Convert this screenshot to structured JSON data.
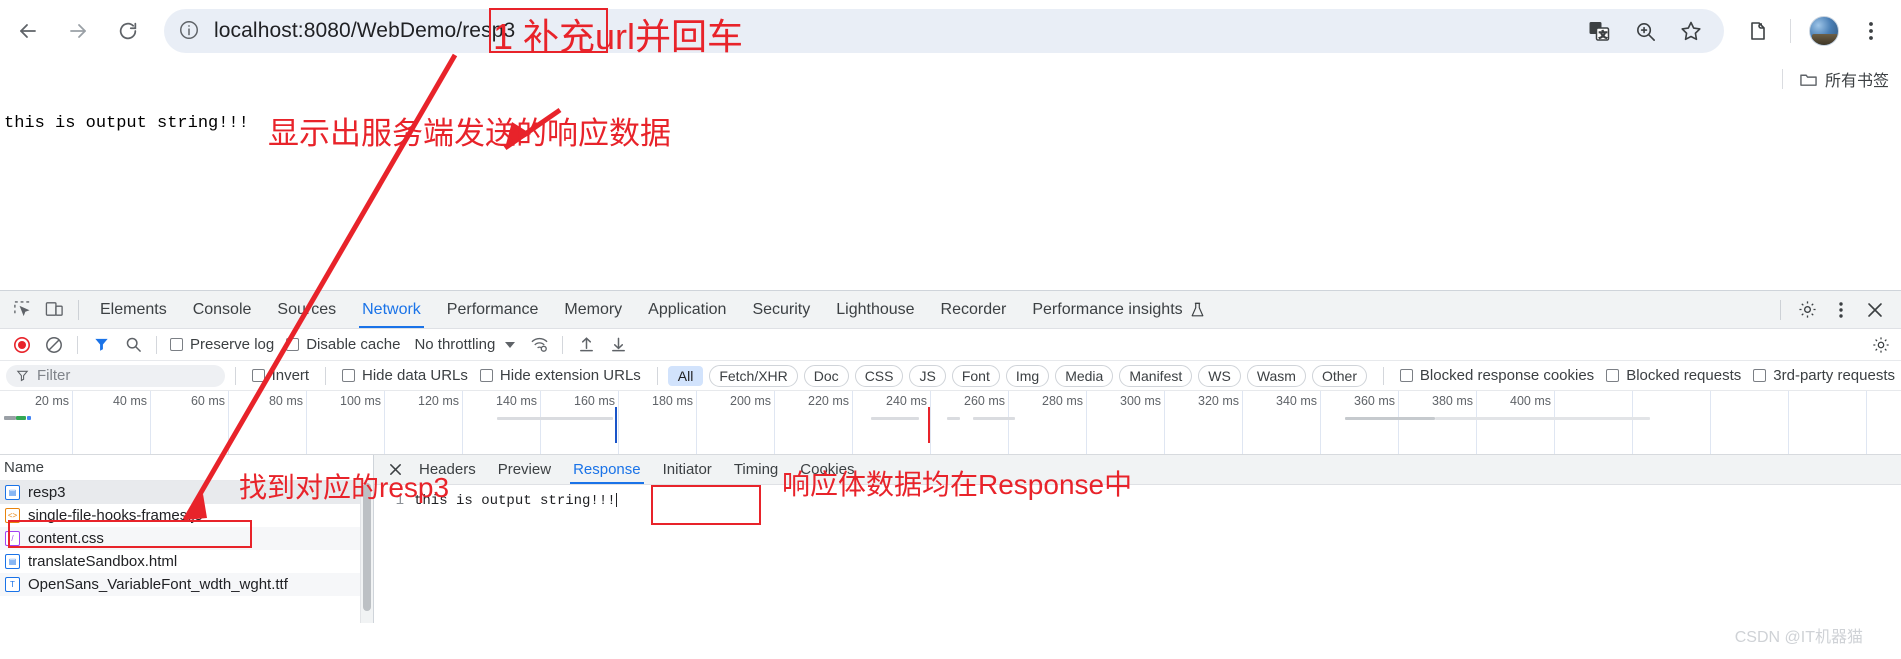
{
  "browser": {
    "back_icon": "back-arrow-icon",
    "forward_icon": "forward-arrow-icon",
    "reload_icon": "reload-icon",
    "site_info_icon": "site-info-icon",
    "url": "localhost:8080/WebDemo/resp3",
    "translate_icon": "translate-icon",
    "zoom_icon": "zoom-icon",
    "bookmark_icon": "star-icon",
    "extensions_icon": "extensions-icon",
    "profile_icon": "avatar-icon",
    "menu_icon": "three-dot-menu-icon"
  },
  "bookmarks": {
    "all_bookmarks_label": "所有书签",
    "folder_icon": "folder-icon"
  },
  "page": {
    "body_text": "this is output string!!!"
  },
  "devtools": {
    "inspect_icon": "inspect-element-icon",
    "device_icon": "device-toolbar-icon",
    "tabs": [
      {
        "label": "Elements",
        "active": false
      },
      {
        "label": "Console",
        "active": false
      },
      {
        "label": "Sources",
        "active": false
      },
      {
        "label": "Network",
        "active": true
      },
      {
        "label": "Performance",
        "active": false
      },
      {
        "label": "Memory",
        "active": false
      },
      {
        "label": "Application",
        "active": false
      },
      {
        "label": "Security",
        "active": false
      },
      {
        "label": "Lighthouse",
        "active": false
      },
      {
        "label": "Recorder",
        "active": false
      },
      {
        "label": "Performance insights",
        "active": false
      }
    ],
    "performance_insights_flask_icon": "flask-icon",
    "settings_icon": "gear-icon",
    "more_icon": "three-dot-menu-icon",
    "close_icon": "close-icon",
    "network_toolbar": {
      "record_icon": "record-stop-icon",
      "clear_icon": "clear-icon",
      "filter_icon": "filter-funnel-icon",
      "search_icon": "search-icon",
      "preserve_log_label": "Preserve log",
      "preserve_log_checked": false,
      "disable_cache_label": "Disable cache",
      "disable_cache_checked": false,
      "throttling_value": "No throttling",
      "network_conditions_icon": "wifi-settings-icon",
      "import_icon": "upload-har-icon",
      "export_icon": "download-har-icon",
      "right_settings_icon": "gear-icon"
    },
    "filter_bar": {
      "filter_placeholder": "Filter",
      "filter_value": "",
      "filter_icon": "filter-funnel-icon",
      "invert_label": "Invert",
      "invert_checked": false,
      "hide_data_urls_label": "Hide data URLs",
      "hide_data_urls_checked": false,
      "hide_extension_urls_label": "Hide extension URLs",
      "hide_extension_urls_checked": false,
      "types": [
        {
          "label": "All",
          "active": true
        },
        {
          "label": "Fetch/XHR",
          "active": false
        },
        {
          "label": "Doc",
          "active": false
        },
        {
          "label": "CSS",
          "active": false
        },
        {
          "label": "JS",
          "active": false
        },
        {
          "label": "Font",
          "active": false
        },
        {
          "label": "Img",
          "active": false
        },
        {
          "label": "Media",
          "active": false
        },
        {
          "label": "Manifest",
          "active": false
        },
        {
          "label": "WS",
          "active": false
        },
        {
          "label": "Wasm",
          "active": false
        },
        {
          "label": "Other",
          "active": false
        }
      ],
      "blocked_response_cookies_label": "Blocked response cookies",
      "blocked_response_cookies_checked": false,
      "blocked_requests_label": "Blocked requests",
      "blocked_requests_checked": false,
      "third_party_requests_label": "3rd-party requests",
      "third_party_requests_checked": false
    },
    "overview": {
      "ticks": [
        "20 ms",
        "40 ms",
        "60 ms",
        "80 ms",
        "100 ms",
        "120 ms",
        "140 ms",
        "160 ms",
        "180 ms",
        "200 ms",
        "220 ms",
        "240 ms",
        "260 ms",
        "280 ms",
        "300 ms",
        "320 ms",
        "340 ms",
        "360 ms",
        "380 ms",
        "400 ms"
      ]
    },
    "requests": {
      "name_column_header": "Name",
      "rows": [
        {
          "name": "resp3",
          "icon": "document-file-icon",
          "selected": true
        },
        {
          "name": "single-file-hooks-frames.js",
          "icon": "js-file-icon",
          "selected": false
        },
        {
          "name": "content.css",
          "icon": "css-file-icon",
          "selected": false
        },
        {
          "name": "translateSandbox.html",
          "icon": "html-file-icon",
          "selected": false
        },
        {
          "name": "OpenSans_VariableFont_wdth_wght.ttf",
          "icon": "font-file-icon",
          "selected": false
        }
      ]
    },
    "detail": {
      "close_icon": "close-icon",
      "tabs": [
        {
          "label": "Headers",
          "active": false
        },
        {
          "label": "Preview",
          "active": false
        },
        {
          "label": "Response",
          "active": true
        },
        {
          "label": "Initiator",
          "active": false
        },
        {
          "label": "Timing",
          "active": false
        },
        {
          "label": "Cookies",
          "active": false
        }
      ],
      "response_lines": [
        {
          "num": "1",
          "text": "this is output string!!!"
        }
      ]
    }
  },
  "annotations": {
    "color": "#e8232a",
    "step1": "1 补充url并回车",
    "note_response_data": "显示出服务端发送的响应数据",
    "note_find_resp3": "找到对应的resp3",
    "note_response_tab": "响应体数据均在Response中"
  },
  "watermark": "CSDN @IT机器猫"
}
